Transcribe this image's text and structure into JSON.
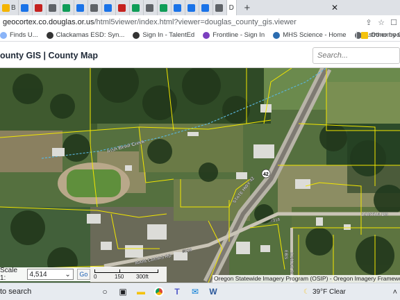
{
  "browser": {
    "tabs": [
      {
        "label": "B",
        "color": "#f4b400"
      },
      {
        "label": "",
        "color": "#1a73e8"
      },
      {
        "label": "",
        "color": "#c5221f"
      },
      {
        "label": "",
        "color": "#5f6368"
      },
      {
        "label": "",
        "color": "#0f9d58"
      },
      {
        "label": "",
        "color": "#1a73e8"
      },
      {
        "label": "",
        "color": "#5f6368"
      },
      {
        "label": "",
        "color": "#1a73e8"
      },
      {
        "label": "",
        "color": "#c5221f"
      },
      {
        "label": "",
        "color": "#0f9d58"
      },
      {
        "label": "",
        "color": "#5f6368"
      },
      {
        "label": "",
        "color": "#0f9d58"
      },
      {
        "label": "",
        "color": "#1a73e8"
      },
      {
        "label": "",
        "color": "#1a73e8"
      },
      {
        "label": "",
        "color": "#1a73e8"
      },
      {
        "label": "",
        "color": "#5f6368"
      }
    ],
    "active_tab_label": "D",
    "url_host": "geocortex.co.douglas.or.us",
    "url_path": "/html5viewer/index.html?viewer=douglas_county_gis.viewer",
    "bookmarks": [
      {
        "label": "Finds U...",
        "color": "#8ab4f8"
      },
      {
        "label": "Clackamas ESD: Syn...",
        "color": "#333333"
      },
      {
        "label": "Sign In - TalentEd",
        "color": "#333333"
      },
      {
        "label": "Frontline - Sign In",
        "color": "#7b3fbf"
      },
      {
        "label": "MHS Science - Home",
        "color": "#2b6cb0"
      },
      {
        "label": "Astronomy Calenda...",
        "color": "#5f6368"
      }
    ],
    "other_bookmarks": "Other boo"
  },
  "app": {
    "title": "ounty GIS | County Map",
    "search_placeholder": "Search..."
  },
  "map": {
    "labels": {
      "creek": "Irish Bend Creek",
      "highway_num": "42",
      "road_diag": "STATE HWY 42",
      "dortha": "DORTHA DR",
      "camas": "CAMAS RD",
      "main_camas": "MAIN CAMAS RD",
      "ebs": "EBS",
      "rd_num1": "#318",
      "rd_num2": "#318"
    },
    "scale_label": "Scale 1:",
    "scale_value": "4,514",
    "go_label": "Go",
    "scalebar_ticks": [
      "0",
      "150",
      "300ft"
    ],
    "attribution": "Oregon Statewide Imagery Program (OSIP) - Oregon Imagery Framework Im"
  },
  "taskbar": {
    "search_text": "to search",
    "weather": "39°F  Clear"
  }
}
